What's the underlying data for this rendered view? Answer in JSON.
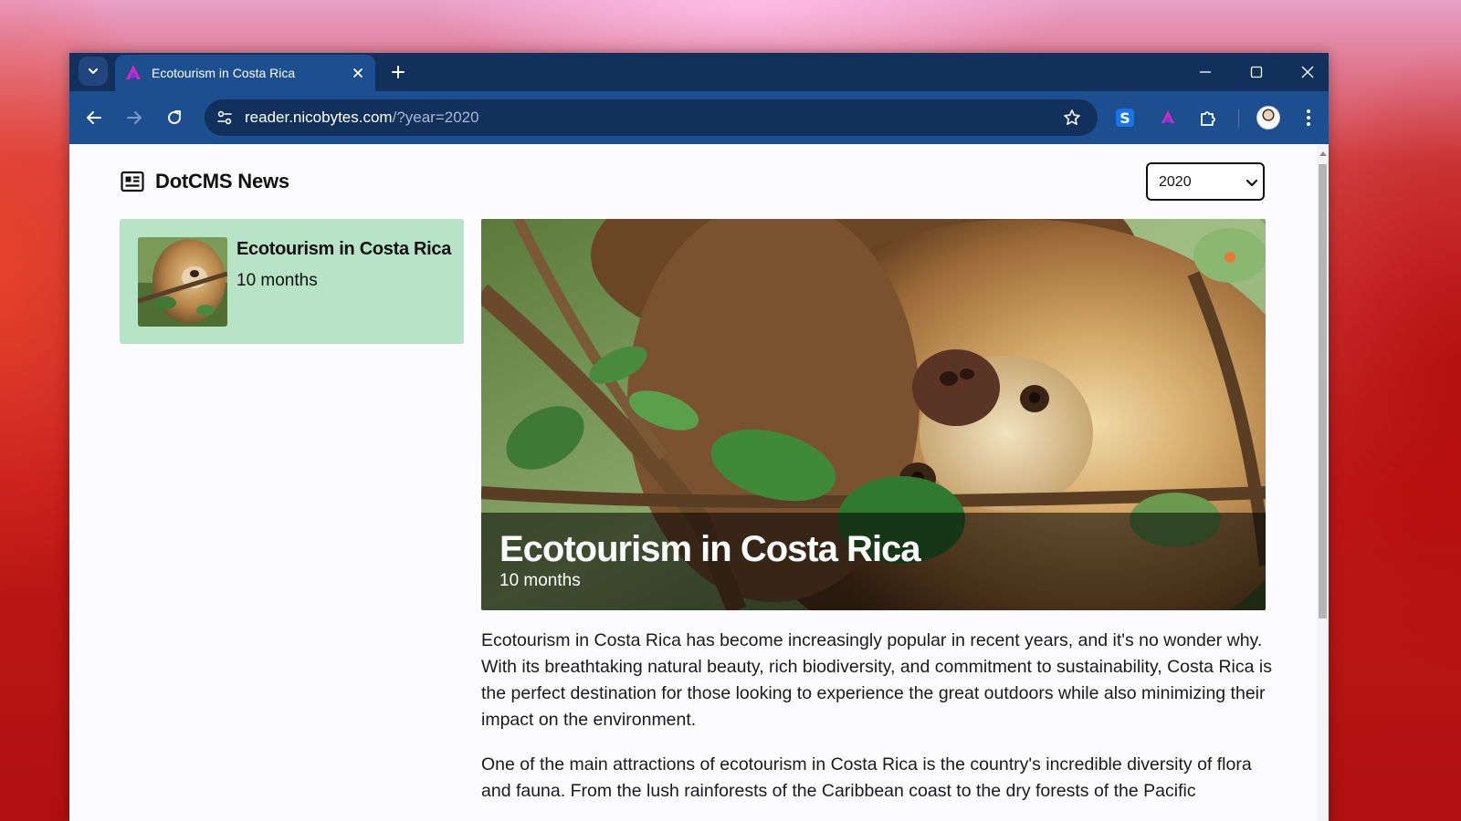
{
  "browser": {
    "tab_title": "Ecotourism in Costa Rica",
    "url_host": "reader.nicobytes.com",
    "url_path": "/?year=2020"
  },
  "header": {
    "brand_title": "DotCMS News",
    "year_selected": "2020"
  },
  "sidebar": {
    "items": [
      {
        "title": "Ecotourism in Costa Rica",
        "meta": "10 months"
      }
    ]
  },
  "hero": {
    "title": "Ecotourism in Costa Rica",
    "meta": "10 months"
  },
  "article": {
    "paragraphs": [
      "Ecotourism in Costa Rica has become increasingly popular in recent years, and it's no wonder why. With its breathtaking natural beauty, rich biodiversity, and commitment to sustainability, Costa Rica is the perfect destination for those looking to experience the great outdoors while also minimizing their impact on the environment.",
      "One of the main attractions of ecotourism in Costa Rica is the country's incredible diversity of flora and fauna. From the lush rainforests of the Caribbean coast to the dry forests of the Pacific"
    ]
  },
  "colors": {
    "tabstrip": "#12305c",
    "toolbar": "#1d4e8f",
    "card_background": "#b7e4c7"
  }
}
